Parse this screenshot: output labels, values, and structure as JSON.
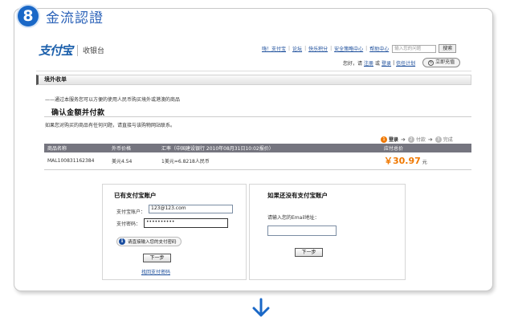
{
  "step": {
    "number": "8",
    "title": "金流認證"
  },
  "brand": {
    "logo_text": "支付宝",
    "subtitle": "收银台"
  },
  "top_links": [
    "嗨！支付宝",
    "论坛",
    "快乐积分",
    "安全策略中心",
    "帮助中心"
  ],
  "search": {
    "placeholder": "输入您的问题",
    "button": "搜索"
  },
  "greeting": {
    "prefix": "您好，请",
    "login": "注册",
    "or": "或",
    "register": "登录",
    "trust": "信任计划",
    "recharge": "立即充值"
  },
  "section_title": "境外收单",
  "notice": "——通过本服务您可以方便的使用人民币购买境外或港澳的商品",
  "confirm_title": "确认金额并付款",
  "help_text": "如果您对购买的商品有任何问题，请直接与该购物网站联系。",
  "steps": {
    "s1": "登录",
    "s2": "付款",
    "s3": "完成",
    "n1": "1",
    "n2": "2",
    "n3": "3"
  },
  "table": {
    "headers": [
      "商品名称",
      "外币价格",
      "汇率（中国建设银行 2010年08月31日10:02报价）",
      "应付总价"
    ],
    "row": {
      "name": "MAL100831162384",
      "price": "美元4.54",
      "rate": "1美元=6.8218人民币",
      "total": "￥30.97",
      "unit": "元"
    }
  },
  "login_panel": {
    "title": "已有支付宝账户",
    "account_label": "支付宝账户：",
    "account_value": "123@123.com",
    "password_label": "支付密码：",
    "password_value": "••••••••••",
    "info": "请直接输入您的支付密码",
    "next": "下一步",
    "forgot": "找回支付密码"
  },
  "guest_panel": {
    "title": "如果还没有支付宝账户",
    "email_label": "请输入您的Email地址：",
    "next": "下一步"
  },
  "colors": {
    "accent": "#1a68c7",
    "amount": "#f07800",
    "table_header": "#75757f"
  }
}
